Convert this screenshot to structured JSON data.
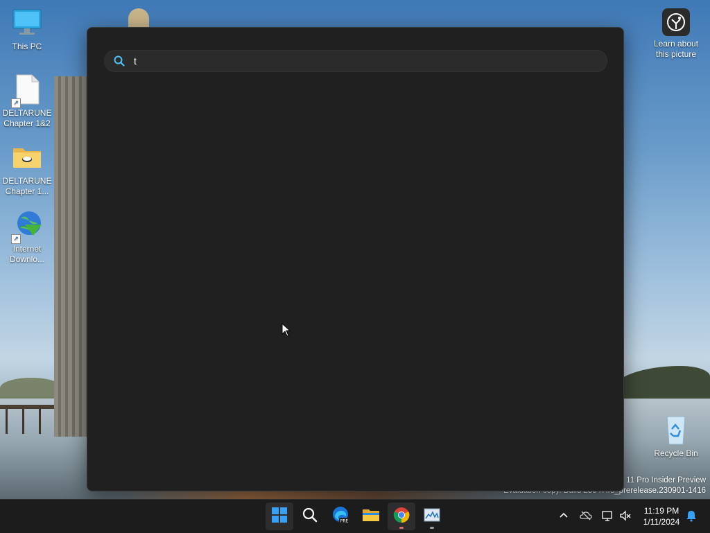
{
  "desktop": {
    "icons": [
      {
        "label": "This PC"
      },
      {
        "label": "DELTARUNE Chapter 1&2"
      },
      {
        "label": "DELTARUNE Chapter 1..."
      },
      {
        "label": "Internet Downlo..."
      }
    ],
    "learn_about": "Learn about this picture",
    "recycle_bin": "Recycle Bin"
  },
  "watermark": {
    "line1": "11 Pro Insider Preview",
    "line2": "Evaluation copy. Build 25947.rs_prerelease.230901-1416"
  },
  "search": {
    "query": "t",
    "icon": "search-icon"
  },
  "taskbar": {
    "apps": [
      {
        "name": "start",
        "icon": "windows-logo-icon"
      },
      {
        "name": "search",
        "icon": "search-icon"
      },
      {
        "name": "edge-preview",
        "icon": "edge-icon",
        "badge": "PRE"
      },
      {
        "name": "file-explorer",
        "icon": "folder-icon"
      },
      {
        "name": "chrome",
        "icon": "chrome-icon"
      },
      {
        "name": "task-manager",
        "icon": "task-manager-icon"
      }
    ],
    "clock": {
      "time": "11:19 PM",
      "date": "1/11/2024"
    },
    "accent": "#0078d4"
  }
}
